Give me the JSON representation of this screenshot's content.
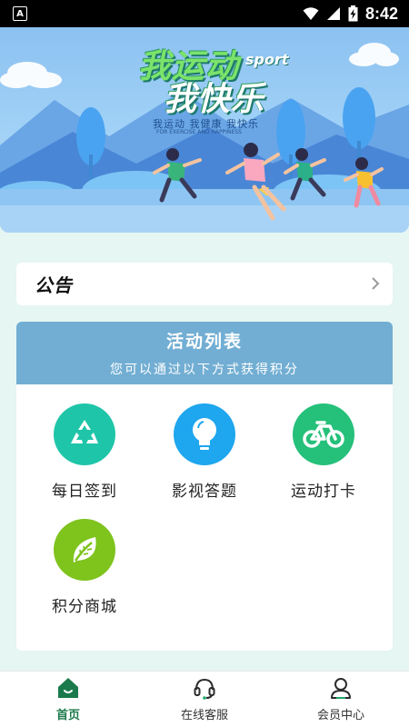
{
  "status_bar": {
    "app_icon_letter": "A",
    "time": "8:42"
  },
  "banner": {
    "title_line1": "我运动",
    "title_line2": "我快乐",
    "title_sport": "sport",
    "subtitle": "我运动 我健康 我快乐",
    "tiny_text": "FOR EXERCISE AND HAPPINESS"
  },
  "notice": {
    "label": "公告"
  },
  "activity": {
    "title": "活动列表",
    "subtitle": "您可以通过以下方式获得积分",
    "items": [
      {
        "label": "每日签到",
        "icon": "recycle-icon",
        "color": "#1fc5a8"
      },
      {
        "label": "影视答题",
        "icon": "lightbulb-icon",
        "color": "#1ea6ee"
      },
      {
        "label": "运动打卡",
        "icon": "bicycle-icon",
        "color": "#25c07a"
      },
      {
        "label": "积分商城",
        "icon": "leaf-icon",
        "color": "#7fc31d"
      }
    ]
  },
  "bottom_nav": {
    "items": [
      {
        "label": "首页",
        "icon": "home-icon",
        "active": true
      },
      {
        "label": "在线客服",
        "icon": "headset-icon",
        "active": false
      },
      {
        "label": "会员中心",
        "icon": "user-icon",
        "active": false
      }
    ],
    "active_color": "#1b7a4b"
  }
}
